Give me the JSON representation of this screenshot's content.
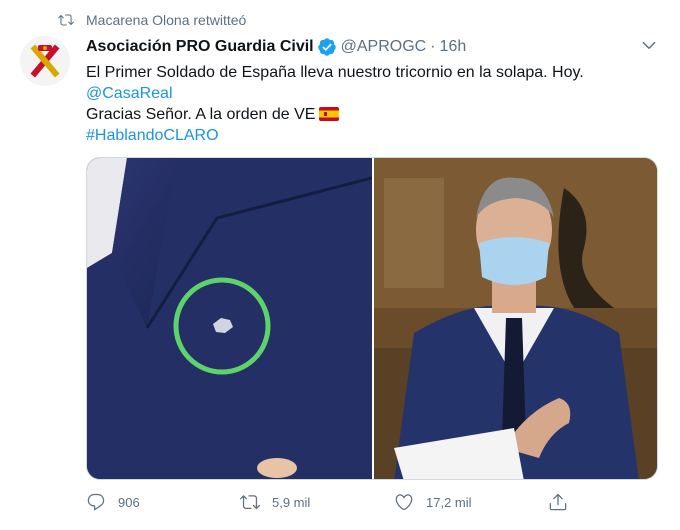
{
  "retweet": {
    "text": "Macarena Olona retwitteó",
    "icon": "retweet-icon"
  },
  "tweet": {
    "author_name": "Asociación PRO Guardia Civil",
    "verified_icon": "verified-badge-icon",
    "handle": "@APROGC",
    "separator": "·",
    "time": "16h",
    "lines": {
      "line1": "El Primer Soldado de España lleva nuestro tricornio en la solapa. Hoy.",
      "mention": "@CasaReal",
      "line3": "Gracias Señor. A la orden de VE",
      "hashtag": "#HablandoCLARO"
    },
    "flag_icon": "spain-flag-icon"
  },
  "actions": {
    "reply_count": "906",
    "retweet_count": "5,9 mil",
    "like_count": "17,2 mil"
  },
  "colors": {
    "link": "#1b95e0",
    "muted": "#5b7083",
    "verified": "#1da1f2",
    "highlight_circle": "#5ed36b"
  }
}
